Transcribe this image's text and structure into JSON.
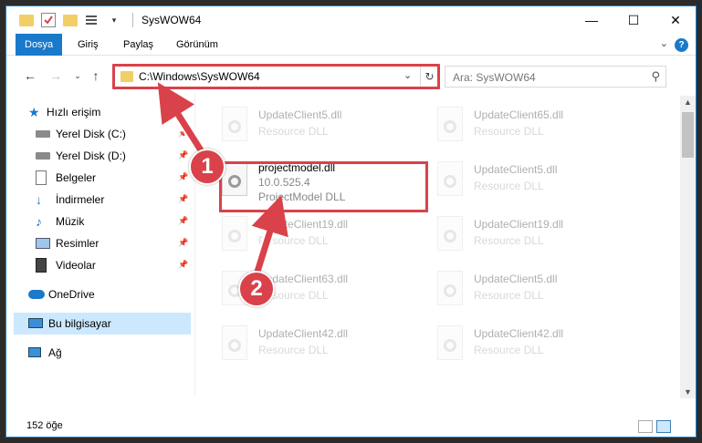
{
  "window": {
    "title": "SysWOW64"
  },
  "tabs": [
    {
      "label": "Dosya",
      "active": true
    },
    {
      "label": "Giriş",
      "active": false
    },
    {
      "label": "Paylaş",
      "active": false
    },
    {
      "label": "Görünüm",
      "active": false
    }
  ],
  "nav": {
    "address": "C:\\Windows\\SysWOW64",
    "search_placeholder": "Ara: SysWOW64"
  },
  "sidebar": {
    "items": [
      {
        "label": "Hızlı erişim",
        "icon": "star-icon",
        "pinned": false
      },
      {
        "label": "Yerel Disk (C:)",
        "icon": "drive-icon",
        "pinned": true
      },
      {
        "label": "Yerel Disk (D:)",
        "icon": "drive-icon",
        "pinned": true
      },
      {
        "label": "Belgeler",
        "icon": "documents-icon",
        "pinned": true
      },
      {
        "label": "İndirmeler",
        "icon": "download-icon",
        "pinned": true
      },
      {
        "label": "Müzik",
        "icon": "music-icon",
        "pinned": true
      },
      {
        "label": "Resimler",
        "icon": "pictures-icon",
        "pinned": true
      },
      {
        "label": "Videolar",
        "icon": "videos-icon",
        "pinned": true
      },
      {
        "label": "OneDrive",
        "icon": "cloud-icon",
        "pinned": false
      },
      {
        "label": "Bu bilgisayar",
        "icon": "computer-icon",
        "pinned": false,
        "selected": true
      },
      {
        "label": "Ağ",
        "icon": "network-icon",
        "pinned": false
      }
    ]
  },
  "files": [
    {
      "name": "UpdateClient5.dll",
      "sub": "Resource DLL",
      "faded": true
    },
    {
      "name": "UpdateClient65.dll",
      "sub": "Resource DLL",
      "faded": true
    },
    {
      "name": "projectmodel.dll",
      "version": "10.0.525.4",
      "sub": "ProjectModel DLL",
      "faded": false
    },
    {
      "name": "UpdateClient5.dll",
      "sub": "Resource DLL",
      "faded": true
    },
    {
      "name": "UpdateClient19.dll",
      "sub": "Resource DLL",
      "faded": true
    },
    {
      "name": "UpdateClient19.dll",
      "sub": "Resource DLL",
      "faded": true
    },
    {
      "name": "UpdateClient63.dll",
      "sub": "Resource DLL",
      "faded": true
    },
    {
      "name": "UpdateClient5.dll",
      "sub": "Resource DLL",
      "faded": true
    },
    {
      "name": "UpdateClient42.dll",
      "sub": "Resource DLL",
      "faded": true
    },
    {
      "name": "UpdateClient42.dll",
      "sub": "Resource DLL",
      "faded": true
    }
  ],
  "status": {
    "item_count": "152 öğe"
  },
  "annotations": {
    "badge1": "1",
    "badge2": "2",
    "color": "#d9424a"
  },
  "colors": {
    "accent": "#1979ca",
    "selected_bg": "#cce8ff",
    "folder": "#f2cf66"
  }
}
